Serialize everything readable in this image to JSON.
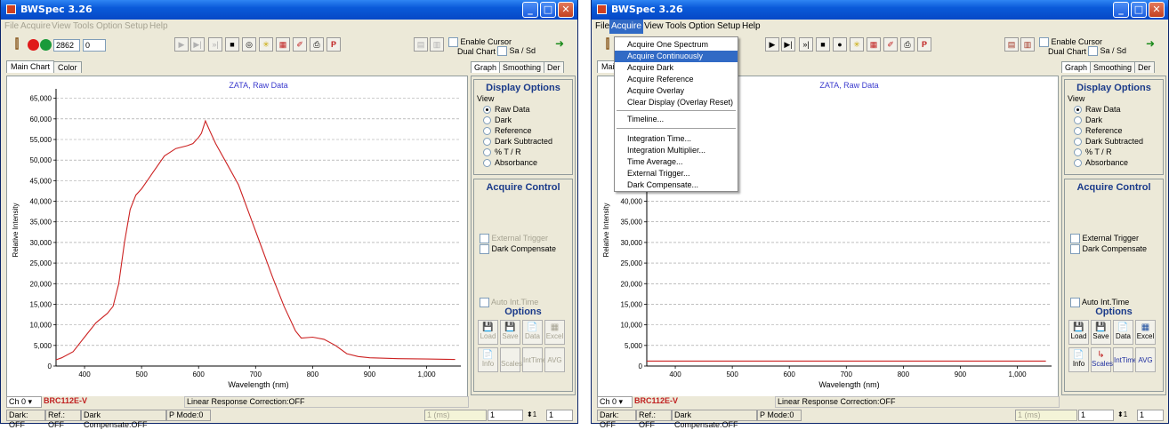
{
  "app": {
    "title": "BWSpec 3.26"
  },
  "menu": [
    "File",
    "Acquire",
    "View",
    "Tools",
    "Option",
    "Setup",
    "Help"
  ],
  "toolbar": {
    "integration_value": "2862",
    "second_value": "0",
    "enable_cursor": "Enable Cursor",
    "dual_chart": "Dual Chart",
    "sa_sd": "Sa / Sd"
  },
  "tabs": [
    "Main Chart",
    "Color"
  ],
  "right_tabs": [
    "Graph",
    "Smoothing",
    "Der"
  ],
  "display_options": {
    "title": "Display Options",
    "view_label": "View",
    "options": [
      "Raw Data",
      "Dark",
      "Reference",
      "Dark Subtracted",
      "% T / R",
      "Absorbance"
    ],
    "selected": "Raw Data"
  },
  "acquire_control": {
    "title": "Acquire Control",
    "external_trigger": "External Trigger",
    "dark_compensate": "Dark Compensate",
    "auto_int_time": "Auto Int.Time"
  },
  "options": {
    "title": "Options",
    "buttons": [
      "Load",
      "Save",
      "Data",
      "Excel",
      "Info",
      "Scales",
      "IntTime",
      "AVG"
    ]
  },
  "status": {
    "channel": "Ch 0",
    "device": "BRC112E-V",
    "linear": "Linear Response Correction:OFF",
    "dark": "Dark: OFF",
    "ref": "Ref.: OFF",
    "dark_comp": "Dark Compensate:OFF",
    "pmode": "P Mode:0",
    "ms": "1 (ms)",
    "avg_value": "1",
    "box_value": "1"
  },
  "acquire_menu": {
    "items": [
      "Acquire One Spectrum",
      "Acquire Continuously",
      "Acquire Dark",
      "Acquire Reference",
      "Acquire Overlay",
      "Clear Display (Overlay Reset)",
      "Timeline...",
      "Integration Time...",
      "Integration Multiplier...",
      "Time Average...",
      "External Trigger...",
      "Dark Compensate..."
    ],
    "highlighted": "Acquire Continuously"
  },
  "chart_data": [
    {
      "type": "line",
      "title": "ZATA, Raw Data",
      "xlabel": "Wavelength (nm)",
      "ylabel": "Relative Intensity",
      "xlim": [
        350,
        1060
      ],
      "ylim": [
        0,
        66000
      ],
      "x_ticks": [
        400,
        500,
        600,
        700,
        800,
        900,
        1000
      ],
      "x_tick_labels": [
        "400",
        "500",
        "600",
        "700",
        "800",
        "900",
        "1,000"
      ],
      "y_ticks": [
        0,
        5000,
        10000,
        15000,
        20000,
        25000,
        30000,
        35000,
        40000,
        45000,
        50000,
        55000,
        60000,
        65000
      ],
      "y_tick_labels": [
        "0",
        "5,000",
        "10,000",
        "15,000",
        "20,000",
        "25,000",
        "30,000",
        "35,000",
        "40,000",
        "45,000",
        "50,000",
        "55,000",
        "60,000",
        "65,000"
      ],
      "grid": true,
      "series": [
        {
          "color": "#cc2222",
          "x": [
            350,
            360,
            380,
            400,
            420,
            440,
            450,
            460,
            470,
            480,
            490,
            500,
            510,
            520,
            540,
            560,
            580,
            590,
            600,
            605,
            612,
            620,
            630,
            650,
            670,
            690,
            710,
            730,
            750,
            770,
            780,
            800,
            820,
            840,
            860,
            880,
            900,
            950,
            1000,
            1050
          ],
          "y": [
            1500,
            2000,
            3500,
            7000,
            10500,
            12800,
            14500,
            20000,
            30000,
            38000,
            41500,
            43000,
            45000,
            47000,
            51000,
            52800,
            53500,
            54000,
            55500,
            56500,
            59500,
            57000,
            54000,
            49000,
            44000,
            36500,
            29000,
            21500,
            14500,
            8500,
            6800,
            7000,
            6500,
            5000,
            3000,
            2300,
            2000,
            1800,
            1700,
            1600
          ]
        }
      ]
    },
    {
      "type": "line",
      "title": "ZATA, Raw Data",
      "xlabel": "Wavelength (nm)",
      "ylabel": "Relative Intensity",
      "xlim": [
        350,
        1060
      ],
      "ylim": [
        0,
        66000
      ],
      "x_ticks": [
        400,
        500,
        600,
        700,
        800,
        900,
        1000
      ],
      "x_tick_labels": [
        "400",
        "500",
        "600",
        "700",
        "800",
        "900",
        "1,000"
      ],
      "y_ticks": [
        0,
        5000,
        10000,
        15000,
        20000,
        25000,
        30000,
        35000,
        40000
      ],
      "y_tick_labels": [
        "0",
        "5,000",
        "10,000",
        "15,000",
        "20,000",
        "25,000",
        "30,000",
        "35,000",
        "40,000"
      ],
      "grid": true,
      "series": [
        {
          "color": "#cc2222",
          "x": [
            350,
            450,
            550,
            650,
            750,
            850,
            950,
            1050
          ],
          "y": [
            1200,
            1200,
            1200,
            1200,
            1200,
            1200,
            1200,
            1200
          ]
        }
      ]
    }
  ]
}
